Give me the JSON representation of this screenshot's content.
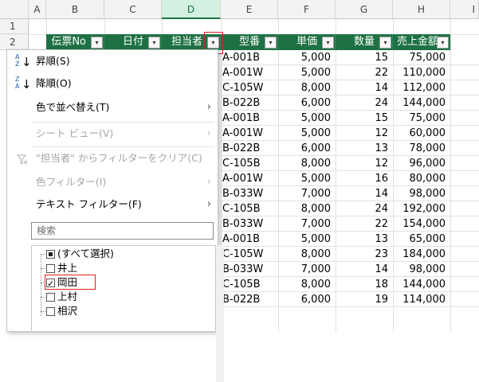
{
  "columns": [
    "",
    "A",
    "B",
    "C",
    "D",
    "E",
    "F",
    "G",
    "H",
    "I"
  ],
  "rows": [
    "1",
    "2"
  ],
  "table_headers": [
    "伝票No",
    "日付",
    "担当者",
    "型番",
    "単価",
    "数量",
    "売上金額"
  ],
  "filter_glyph": "▾",
  "data_rows": [
    [
      "A-001B",
      "5,000",
      "15",
      "75,000"
    ],
    [
      "A-001W",
      "5,000",
      "22",
      "110,000"
    ],
    [
      "C-105W",
      "8,000",
      "14",
      "112,000"
    ],
    [
      "B-022B",
      "6,000",
      "24",
      "144,000"
    ],
    [
      "A-001B",
      "5,000",
      "15",
      "75,000"
    ],
    [
      "A-001W",
      "5,000",
      "12",
      "60,000"
    ],
    [
      "B-022B",
      "6,000",
      "13",
      "78,000"
    ],
    [
      "C-105B",
      "8,000",
      "12",
      "96,000"
    ],
    [
      "A-001W",
      "5,000",
      "16",
      "80,000"
    ],
    [
      "B-033W",
      "7,000",
      "14",
      "98,000"
    ],
    [
      "C-105B",
      "8,000",
      "24",
      "192,000"
    ],
    [
      "B-033W",
      "7,000",
      "22",
      "154,000"
    ],
    [
      "A-001B",
      "5,000",
      "13",
      "65,000"
    ],
    [
      "C-105W",
      "8,000",
      "23",
      "184,000"
    ],
    [
      "B-033W",
      "7,000",
      "14",
      "98,000"
    ],
    [
      "C-105B",
      "8,000",
      "18",
      "144,000"
    ],
    [
      "B-022B",
      "6,000",
      "19",
      "114,000"
    ]
  ],
  "menu": {
    "sort_asc": "昇順(S)",
    "sort_desc": "降順(O)",
    "sort_by_color": "色で並べ替え(T)",
    "sheet_view": "シート ビュー(V)",
    "clear_filter": "\"担当者\" からフィルターをクリア(C)",
    "color_filter": "色フィルター(I)",
    "text_filter": "テキスト フィルター(F)",
    "search_placeholder": "検索",
    "arrow": "›",
    "sort_asc_icon_top": "A",
    "sort_asc_icon_bottom": "Z",
    "sort_desc_icon_top": "Z",
    "sort_desc_icon_bottom": "A",
    "list_items": [
      {
        "label": "(すべて選択)",
        "state": "partial"
      },
      {
        "label": "井上",
        "state": "unchecked"
      },
      {
        "label": "岡田",
        "state": "checked"
      },
      {
        "label": "上村",
        "state": "unchecked"
      },
      {
        "label": "相沢",
        "state": "unchecked"
      }
    ]
  },
  "colors": {
    "header_green": "#1e7145",
    "highlight_red": "#e02020"
  }
}
